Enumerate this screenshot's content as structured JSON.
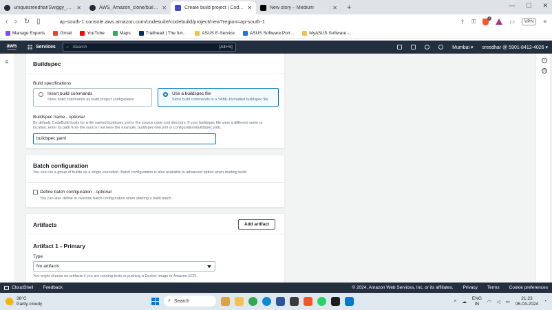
{
  "browser": {
    "tabs": [
      {
        "title": "uniquesreedhar/Swiggy_clone",
        "favicon": "github-icon",
        "color": "#24292f",
        "active": false
      },
      {
        "title": "AWS_Amazon_clone/buildspec.yaml",
        "favicon": "github-icon",
        "color": "#24292f",
        "active": false
      },
      {
        "title": "Create build project | CodeBuild",
        "favicon": "codebuild-icon",
        "color": "#3f48cc",
        "active": true
      },
      {
        "title": "New story – Medium",
        "favicon": "medium-icon",
        "color": "#000000",
        "active": false
      }
    ],
    "new_tab_glyph": "+",
    "url": "ap-south-1.console.aws.amazon.com/codesuite/codebuild/project/new?region=ap-south-1",
    "brave_badge": "1",
    "vpn_label": "VPN",
    "bookmarks": [
      {
        "label": "Manage Exports",
        "icon": "apps-icon",
        "color": "#7c4dff"
      },
      {
        "label": "Gmail",
        "icon": "gmail-icon",
        "color": "#ea4335"
      },
      {
        "label": "YouTube",
        "icon": "youtube-icon",
        "color": "#ff0000"
      },
      {
        "label": "Maps",
        "icon": "maps-icon",
        "color": "#34a853"
      },
      {
        "label": "Trailhead | The fun...",
        "icon": "trailhead-icon",
        "color": "#032d60"
      },
      {
        "label": "ASUS E-Service",
        "icon": "folder-icon",
        "color": "#f2c14e"
      },
      {
        "label": "ASUS Software Port...",
        "icon": "asus-icon",
        "color": "#1a73e8"
      },
      {
        "label": "MyASUS Software -...",
        "icon": "folder-icon",
        "color": "#f2c14e"
      }
    ]
  },
  "aws": {
    "logo": "aws",
    "services": "Services",
    "search_placeholder": "Search",
    "search_shortcut": "[Alt+S]",
    "region": "Mumbai ▾",
    "account": "sreedhar @ 5901-8412-4026 ▾"
  },
  "buildspec": {
    "title": "Buildspec",
    "spec_label": "Build specifications",
    "options": [
      {
        "title": "Insert build commands",
        "desc": "Store build commands as build project configuration",
        "selected": false
      },
      {
        "title": "Use a buildspec file",
        "desc": "Store build commands in a YAML-formatted buildspec file",
        "selected": true
      }
    ],
    "name_label": "Buildspec name",
    "name_optional": " - optional",
    "name_desc": "By default, CodeBuild looks for a file named buildspec.yml in the source code root directory. If your buildspec file uses a different name or location, enter its path from the source root here (for example, buildspec-two.yml or configuration/buildspec.yml).",
    "name_value": "buildspec.yaml"
  },
  "batch": {
    "title": "Batch configuration",
    "desc": "You can run a group of builds as a single execution. Batch configuration is also available in advanced option when starting build.",
    "checkbox_label": "Define batch configuration",
    "checkbox_optional": " - optional",
    "checkbox_desc": "You can also define or override batch configuration when starting a build batch."
  },
  "artifacts": {
    "title": "Artifacts",
    "add_button": "Add artifact",
    "primary_title": "Artifact 1 - Primary",
    "type_label": "Type",
    "type_value": "No artifacts",
    "type_hint": "You might choose no artifacts if you are running tests or pushing a Docker image to Amazon ECR."
  },
  "footer": {
    "cloudshell": "CloudShell",
    "feedback": "Feedback",
    "copyright": "© 2024, Amazon Web Services, Inc. or its affiliates.",
    "privacy": "Privacy",
    "terms": "Terms",
    "cookies": "Cookie preferences"
  },
  "taskbar": {
    "temp": "36°C",
    "weather": "Partly cloudy",
    "search": "Search",
    "lang1": "ENG",
    "lang2": "IN",
    "time": "21:23",
    "date": "06-04-2024",
    "apps": [
      {
        "icon": "game-icon",
        "color": "#d9a441"
      },
      {
        "icon": "file-explorer-icon",
        "color": "#f2c14e"
      },
      {
        "icon": "chrome-icon",
        "color": "#34a853"
      },
      {
        "icon": "edge-icon",
        "color": "#0b8bd6"
      },
      {
        "icon": "store-icon",
        "color": "#2b579a"
      },
      {
        "icon": "m-app-icon",
        "color": "#3c3c3c"
      },
      {
        "icon": "brave-icon",
        "color": "#fb542b"
      },
      {
        "icon": "whatsapp-icon",
        "color": "#25d366"
      },
      {
        "icon": "terminal-icon",
        "color": "#1e1e1e"
      },
      {
        "icon": "vscode-icon",
        "color": "#007acc"
      }
    ]
  }
}
